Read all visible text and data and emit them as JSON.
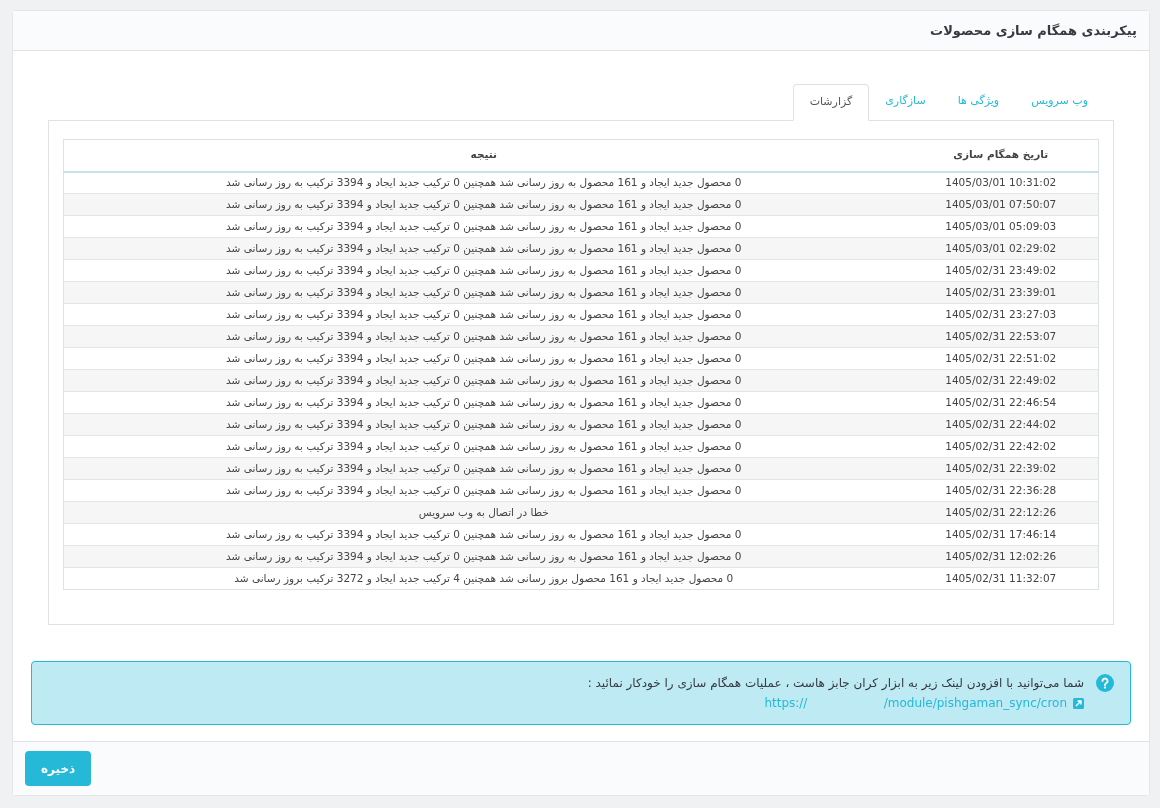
{
  "panel": {
    "title": "پیکربندی همگام سازی محصولات"
  },
  "tabs": [
    {
      "label": "وب سرویس",
      "selected": false
    },
    {
      "label": "ویژگی ها",
      "selected": false
    },
    {
      "label": "سازگاری",
      "selected": false
    },
    {
      "label": "گزارشات",
      "selected": true
    }
  ],
  "table": {
    "columns": [
      "تاریخ همگام سازی",
      "نتیجه"
    ],
    "rows": [
      {
        "date": "1405/03/01 10:31:02",
        "result": "0 محصول جدید ایجاد و 161 محصول به روز رسانی شد همچنین 0 ترکیب جدید ایجاد و 3394 ترکیب به روز رسانی شد"
      },
      {
        "date": "1405/03/01 07:50:07",
        "result": "0 محصول جدید ایجاد و 161 محصول به روز رسانی شد همچنین 0 ترکیب جدید ایجاد و 3394 ترکیب به روز رسانی شد"
      },
      {
        "date": "1405/03/01 05:09:03",
        "result": "0 محصول جدید ایجاد و 161 محصول به روز رسانی شد همچنین 0 ترکیب جدید ایجاد و 3394 ترکیب به روز رسانی شد"
      },
      {
        "date": "1405/03/01 02:29:02",
        "result": "0 محصول جدید ایجاد و 161 محصول به روز رسانی شد همچنین 0 ترکیب جدید ایجاد و 3394 ترکیب به روز رسانی شد"
      },
      {
        "date": "1405/02/31 23:49:02",
        "result": "0 محصول جدید ایجاد و 161 محصول به روز رسانی شد همچنین 0 ترکیب جدید ایجاد و 3394 ترکیب به روز رسانی شد"
      },
      {
        "date": "1405/02/31 23:39:01",
        "result": "0 محصول جدید ایجاد و 161 محصول به روز رسانی شد همچنین 0 ترکیب جدید ایجاد و 3394 ترکیب به روز رسانی شد"
      },
      {
        "date": "1405/02/31 23:27:03",
        "result": "0 محصول جدید ایجاد و 161 محصول به روز رسانی شد همچنین 0 ترکیب جدید ایجاد و 3394 ترکیب به روز رسانی شد"
      },
      {
        "date": "1405/02/31 22:53:07",
        "result": "0 محصول جدید ایجاد و 161 محصول به روز رسانی شد همچنین 0 ترکیب جدید ایجاد و 3394 ترکیب به روز رسانی شد"
      },
      {
        "date": "1405/02/31 22:51:02",
        "result": "0 محصول جدید ایجاد و 161 محصول به روز رسانی شد همچنین 0 ترکیب جدید ایجاد و 3394 ترکیب به روز رسانی شد"
      },
      {
        "date": "1405/02/31 22:49:02",
        "result": "0 محصول جدید ایجاد و 161 محصول به روز رسانی شد همچنین 0 ترکیب جدید ایجاد و 3394 ترکیب به روز رسانی شد"
      },
      {
        "date": "1405/02/31 22:46:54",
        "result": "0 محصول جدید ایجاد و 161 محصول به روز رسانی شد همچنین 0 ترکیب جدید ایجاد و 3394 ترکیب به روز رسانی شد"
      },
      {
        "date": "1405/02/31 22:44:02",
        "result": "0 محصول جدید ایجاد و 161 محصول به روز رسانی شد همچنین 0 ترکیب جدید ایجاد و 3394 ترکیب به روز رسانی شد"
      },
      {
        "date": "1405/02/31 22:42:02",
        "result": "0 محصول جدید ایجاد و 161 محصول به روز رسانی شد همچنین 0 ترکیب جدید ایجاد و 3394 ترکیب به روز رسانی شد"
      },
      {
        "date": "1405/02/31 22:39:02",
        "result": "0 محصول جدید ایجاد و 161 محصول به روز رسانی شد همچنین 0 ترکیب جدید ایجاد و 3394 ترکیب به روز رسانی شد"
      },
      {
        "date": "1405/02/31 22:36:28",
        "result": "0 محصول جدید ایجاد و 161 محصول به روز رسانی شد همچنین 0 ترکیب جدید ایجاد و 3394 ترکیب به روز رسانی شد"
      },
      {
        "date": "1405/02/31 22:12:26",
        "result": "خطا در اتصال به وب سرویس"
      },
      {
        "date": "1405/02/31 17:46:14",
        "result": "0 محصول جدید ایجاد و 161 محصول به روز رسانی شد همچنین 0 ترکیب جدید ایجاد و 3394 ترکیب به روز رسانی شد"
      },
      {
        "date": "1405/02/31 12:02:26",
        "result": "0 محصول جدید ایجاد و 161 محصول به روز رسانی شد همچنین 0 ترکیب جدید ایجاد و 3394 ترکیب به روز رسانی شد"
      },
      {
        "date": "1405/02/31 11:32:07",
        "result": "0 محصول جدید ایجاد و 161 محصول بروز رسانی شد همچنین 4 ترکیب جدید ایجاد و 3272 ترکیب بروز رسانی شد"
      }
    ]
  },
  "alert": {
    "text": "شما می‌توانید با افزودن لینک زیر به ابزار کران جابز هاست ، عملیات همگام سازی را خودکار نمائید :",
    "link": "https://                    /module/pishgaman_sync/cron"
  },
  "buttons": [
    "ذخیره"
  ]
}
